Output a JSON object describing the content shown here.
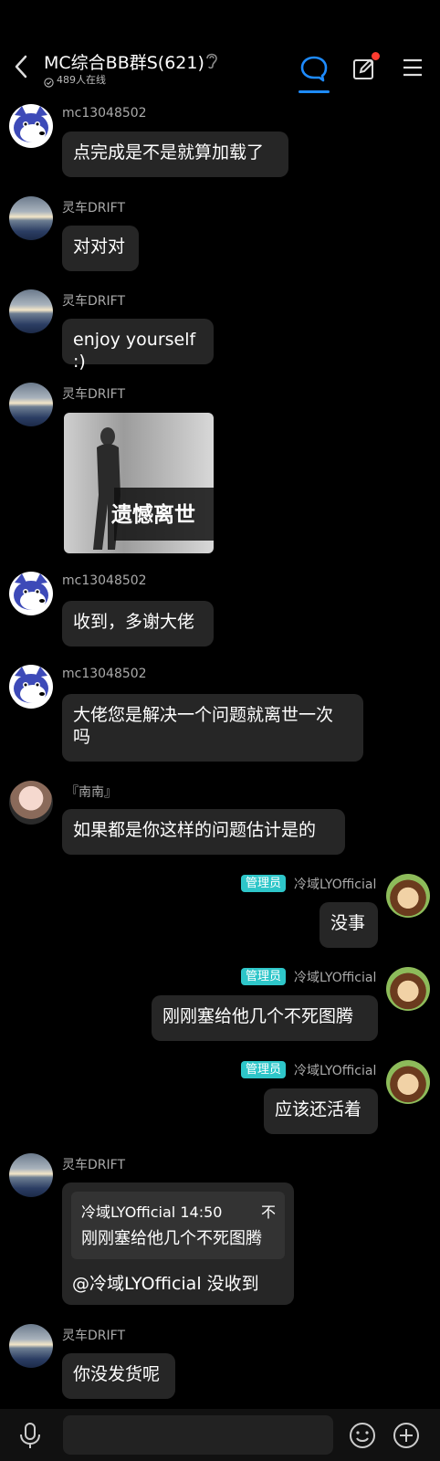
{
  "header": {
    "title": "MC综合BB群S(621)",
    "online": "489人在线"
  },
  "messages": [
    {
      "name": "mc13048502",
      "text": "点完成是不是就算加载了"
    },
    {
      "name": "灵车DRIFT",
      "text": "对对对"
    },
    {
      "name": "灵车DRIFT",
      "text": "enjoy yourself :)"
    },
    {
      "name": "灵车DRIFT",
      "sticker_text": "遗憾离世"
    },
    {
      "name": "mc13048502",
      "text": "收到，多谢大佬"
    },
    {
      "name": "mc13048502",
      "text_line1": "大佬您是解决一个问题就离世一次",
      "text_line2": "吗"
    },
    {
      "name": "『南南』",
      "text": "如果都是你这样的问题估计是的"
    },
    {
      "name": "冷域LYOfficial",
      "role": "管理员",
      "text": "没事"
    },
    {
      "name": "冷域LYOfficial",
      "role": "管理员",
      "text": "刚刚塞给他几个不死图腾"
    },
    {
      "name": "冷域LYOfficial",
      "role": "管理员",
      "text": "应该还活着"
    },
    {
      "name": "灵车DRIFT",
      "quote_header": "冷域LYOfficial 14:50",
      "quote_extra": "不",
      "quote_text": "刚刚塞给他几个不死图腾",
      "text": "@冷域LYOfficial 没收到"
    },
    {
      "name": "灵车DRIFT",
      "text": "你没发货呢"
    }
  ],
  "colors": {
    "accent": "#1e8bff",
    "admin_badge": "#2ec6c9",
    "bubble": "#262626",
    "notify_dot": "#ff3b30"
  },
  "icons": [
    "back-arrow-icon",
    "ear-icon",
    "online-status-icon",
    "chat-bubble-icon",
    "edit-icon",
    "menu-icon",
    "microphone-icon",
    "emoji-icon",
    "plus-icon"
  ]
}
